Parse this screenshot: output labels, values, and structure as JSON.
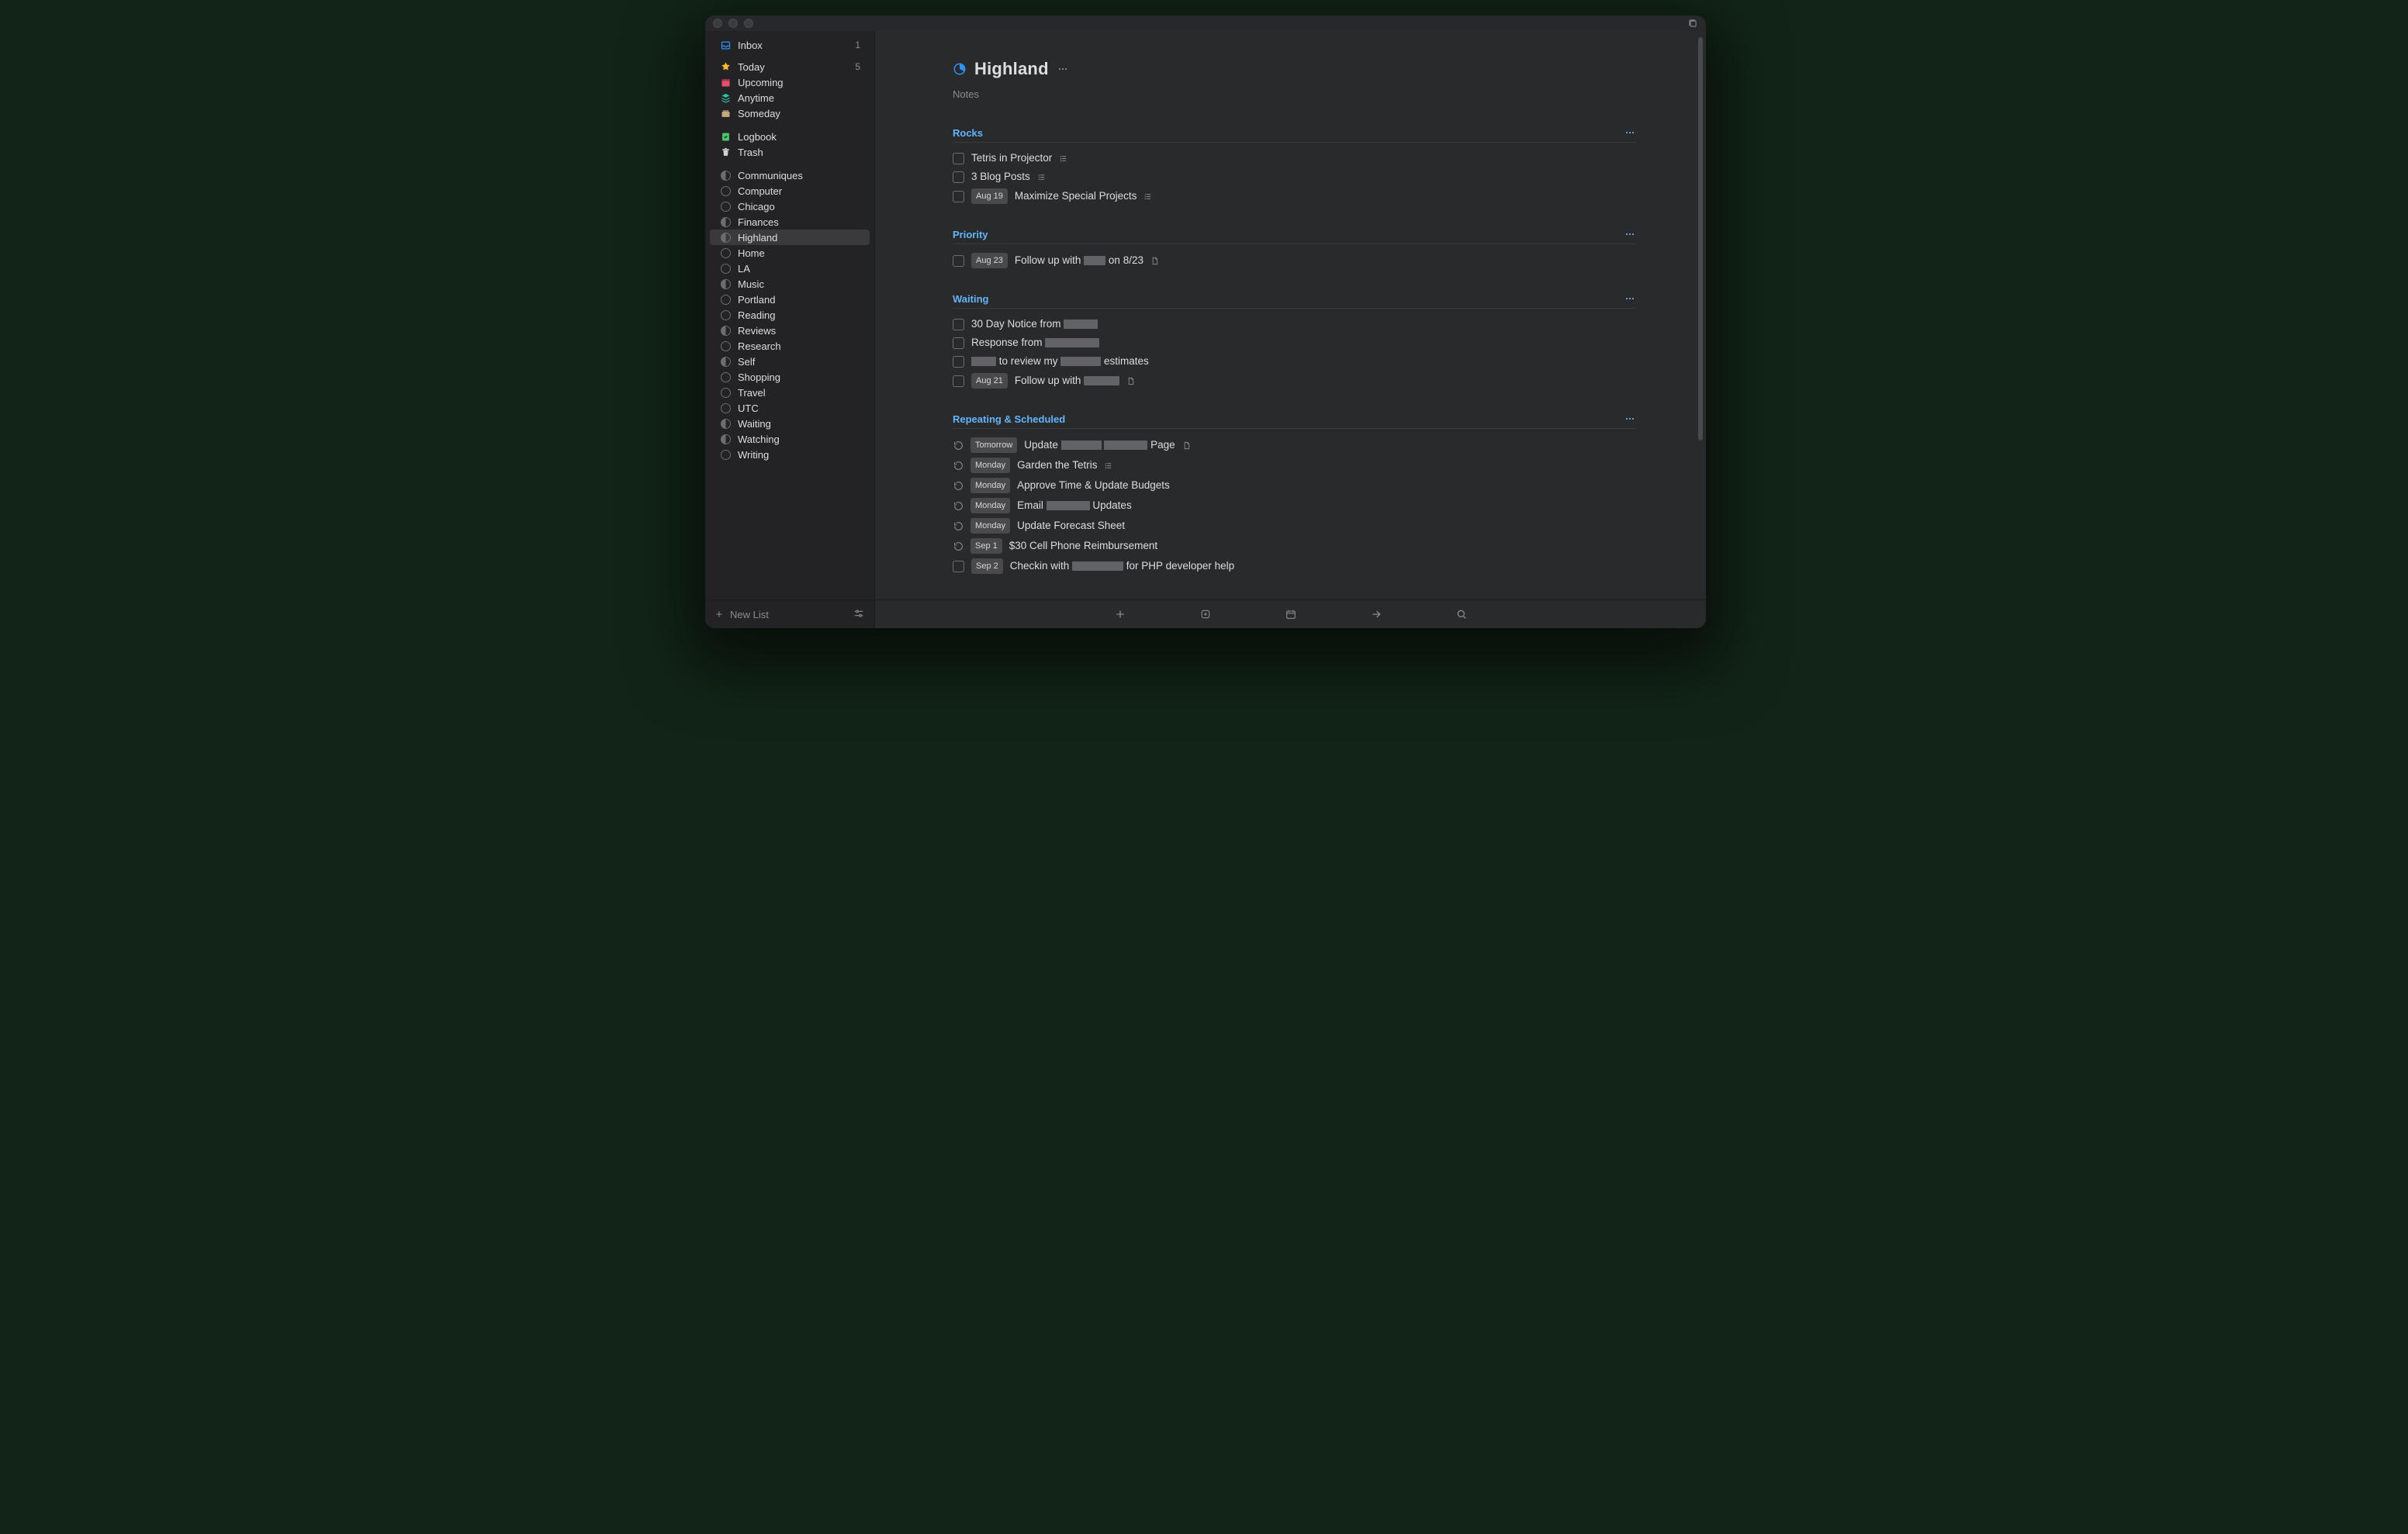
{
  "project": {
    "title": "Highland",
    "notes_placeholder": "Notes"
  },
  "sidebar": {
    "top": [
      {
        "id": "inbox",
        "label": "Inbox",
        "count": "1",
        "color": "#2e92f5"
      },
      {
        "id": "today",
        "label": "Today",
        "count": "5",
        "color": "#fdbc2c"
      },
      {
        "id": "upcoming",
        "label": "Upcoming",
        "color": "#e84f6a"
      },
      {
        "id": "anytime",
        "label": "Anytime",
        "color": "#2dbfa0"
      },
      {
        "id": "someday",
        "label": "Someday",
        "color": "#c6a87c"
      }
    ],
    "mid": [
      {
        "id": "logbook",
        "label": "Logbook",
        "color": "#4cc76b"
      },
      {
        "id": "trash",
        "label": "Trash",
        "color": "#d0d0d0"
      }
    ],
    "areas": [
      {
        "label": "Communiques"
      },
      {
        "label": "Computer"
      },
      {
        "label": "Chicago"
      },
      {
        "label": "Finances"
      },
      {
        "label": "Highland",
        "selected": true
      },
      {
        "label": "Home"
      },
      {
        "label": "LA"
      },
      {
        "label": "Music"
      },
      {
        "label": "Portland"
      },
      {
        "label": "Reading"
      },
      {
        "label": "Reviews"
      },
      {
        "label": "Research"
      },
      {
        "label": "Self"
      },
      {
        "label": "Shopping"
      },
      {
        "label": "Travel"
      },
      {
        "label": "UTC"
      },
      {
        "label": "Waiting"
      },
      {
        "label": "Watching"
      },
      {
        "label": "Writing"
      }
    ],
    "new_list_label": "New List"
  },
  "sections": [
    {
      "id": "rocks",
      "title": "Rocks",
      "tasks": [
        {
          "kind": "todo",
          "title": "Tetris in Projector",
          "trailing": "checklist"
        },
        {
          "kind": "todo",
          "title": "3 Blog Posts",
          "trailing": "checklist"
        },
        {
          "kind": "todo",
          "date": "Aug 19",
          "title": "Maximize Special Projects",
          "trailing": "checklist"
        }
      ]
    },
    {
      "id": "priority",
      "title": "Priority",
      "tasks": [
        {
          "kind": "todo",
          "date": "Aug 23",
          "segments": [
            {
              "t": "Follow up with "
            },
            {
              "r": 28
            },
            {
              "t": " on 8/23"
            }
          ],
          "trailing": "note"
        }
      ]
    },
    {
      "id": "waiting",
      "title": "Waiting",
      "tasks": [
        {
          "kind": "todo",
          "segments": [
            {
              "t": "30 Day Notice from "
            },
            {
              "r": 44
            }
          ]
        },
        {
          "kind": "todo",
          "segments": [
            {
              "t": "Response from "
            },
            {
              "r": 70
            }
          ]
        },
        {
          "kind": "todo",
          "segments": [
            {
              "r": 32
            },
            {
              "t": " to review my "
            },
            {
              "r": 52
            },
            {
              "t": " estimates"
            }
          ]
        },
        {
          "kind": "todo",
          "date": "Aug 21",
          "segments": [
            {
              "t": "Follow up with "
            },
            {
              "r": 46
            }
          ],
          "trailing": "note"
        }
      ]
    },
    {
      "id": "repeating",
      "title": "Repeating & Scheduled",
      "tasks": [
        {
          "kind": "repeat",
          "date": "Tomorrow",
          "segments": [
            {
              "t": "Update "
            },
            {
              "r": 52
            },
            {
              "t": " "
            },
            {
              "r": 56
            },
            {
              "t": " Page"
            }
          ],
          "trailing": "note"
        },
        {
          "kind": "repeat",
          "date": "Monday",
          "title": "Garden the Tetris",
          "trailing": "checklist"
        },
        {
          "kind": "repeat",
          "date": "Monday",
          "title": "Approve Time & Update Budgets"
        },
        {
          "kind": "repeat",
          "date": "Monday",
          "segments": [
            {
              "t": "Email "
            },
            {
              "r": 56
            },
            {
              "t": " Updates"
            }
          ]
        },
        {
          "kind": "repeat",
          "date": "Monday",
          "title": "Update Forecast Sheet"
        },
        {
          "kind": "repeat",
          "date": "Sep 1",
          "title": "$30 Cell Phone Reimbursement"
        },
        {
          "kind": "todo",
          "date": "Sep 2",
          "segments": [
            {
              "t": "Checkin with "
            },
            {
              "r": 66
            },
            {
              "t": " for PHP developer help"
            }
          ]
        }
      ]
    }
  ]
}
